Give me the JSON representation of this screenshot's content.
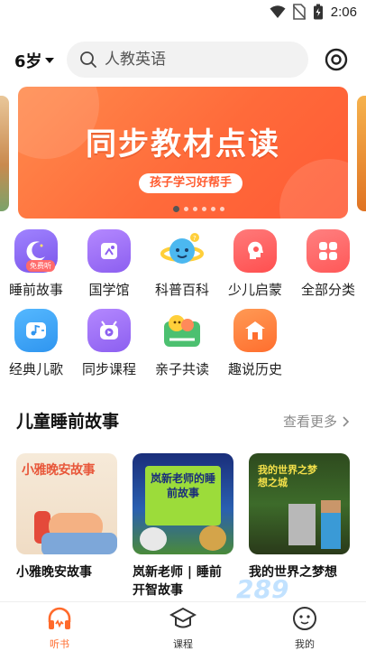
{
  "status_bar": {
    "time": "2:06"
  },
  "header": {
    "age_label": "6岁",
    "search_placeholder": "人教英语"
  },
  "banner": {
    "title": "同步教材点读",
    "subtitle": "孩子学习好帮手",
    "dot_count": 6,
    "active_dot": 0
  },
  "categories": [
    {
      "label": "睡前故事",
      "icon": "moon-icon",
      "badge": "免费听",
      "color": "#8a63f0"
    },
    {
      "label": "国学馆",
      "icon": "book-icon",
      "color": "#9b6cf5"
    },
    {
      "label": "科普百科",
      "icon": "planet-icon",
      "color": "#4cb8f0"
    },
    {
      "label": "少儿启蒙",
      "icon": "head-icon",
      "color": "#ff5a5a"
    },
    {
      "label": "全部分类",
      "icon": "grid-icon",
      "color": "#ff6b6b"
    },
    {
      "label": "经典儿歌",
      "icon": "music-icon",
      "color": "#3fa8f4"
    },
    {
      "label": "同步课程",
      "icon": "play-icon",
      "color": "#a070f5"
    },
    {
      "label": "亲子共读",
      "icon": "family-icon",
      "color": "#4cc070"
    },
    {
      "label": "趣说历史",
      "icon": "house-icon",
      "color": "#ff7a3a"
    }
  ],
  "section": {
    "title": "儿童睡前故事",
    "see_more": "查看更多"
  },
  "cards": [
    {
      "title": "小雅晚安故事",
      "cover_text": "小雅晚安故事"
    },
    {
      "title": "岚新老师 | 睡前开智故事",
      "cover_text": "岚新老师的睡前故事"
    },
    {
      "title": "我的世界之梦想",
      "cover_text": "我的世界之梦想之城"
    }
  ],
  "bottom_nav": [
    {
      "label": "听书",
      "icon": "headphones-icon",
      "active": true
    },
    {
      "label": "课程",
      "icon": "graduation-cap-icon",
      "active": false
    },
    {
      "label": "我的",
      "icon": "profile-face-icon",
      "active": false
    }
  ],
  "watermark": "289"
}
